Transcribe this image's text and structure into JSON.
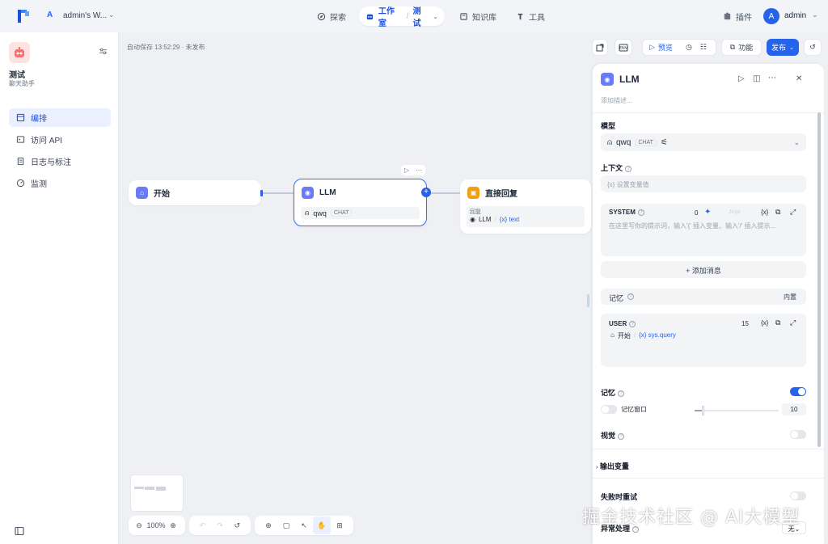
{
  "topbar": {
    "workspace_badge": "A",
    "workspace_name": "admin's W...",
    "nav": [
      {
        "label": "探索"
      },
      {
        "label": "工作室"
      },
      {
        "label": "测试"
      },
      {
        "label": "知识库"
      },
      {
        "label": "工具"
      }
    ],
    "plugins_label": "插件",
    "user_initial": "A",
    "user_name": "admin"
  },
  "sidebar": {
    "app_title": "测试",
    "app_subtitle": "聊天助手",
    "items": [
      {
        "label": "编排"
      },
      {
        "label": "访问 API"
      },
      {
        "label": "日志与标注"
      },
      {
        "label": "监测"
      }
    ]
  },
  "canvas": {
    "status": "自动保存 13:52:29 · 未发布",
    "toolbar": {
      "preview_label": "预览",
      "features_label": "功能",
      "publish_label": "发布"
    },
    "nodes": {
      "start": {
        "title": "开始"
      },
      "llm": {
        "title": "LLM",
        "model": "qwq",
        "model_tag": "CHAT"
      },
      "answer": {
        "title": "直接回复",
        "sub_label": "回复",
        "ref_node": "LLM",
        "ref_var": "{x} text"
      }
    },
    "zoom": "100%"
  },
  "panel": {
    "title": "LLM",
    "description_placeholder": "添加描述...",
    "model_label": "模型",
    "model_name": "qwq",
    "model_tag": "CHAT",
    "context_label": "上下文",
    "context_placeholder": "{x} 设置变量值",
    "system": {
      "label": "SYSTEM",
      "count": "0",
      "jinja": "Jinja",
      "placeholder": "在这里写你的提示词，输入'{' 插入变量、输入'/' 插入提示..."
    },
    "add_message_label": "+ 添加消息",
    "memory_row_label": "记忆",
    "memory_builtin": "内置",
    "user": {
      "label": "USER",
      "count": "15",
      "start_ref": "开始",
      "var_ref": "{x} sys.query"
    },
    "memory_label": "记忆",
    "memory_window_label": "记忆窗口",
    "memory_window_value": "10",
    "vision_label": "视觉",
    "output_vars_label": "输出变量",
    "retry_label": "失败时重试",
    "exception_label": "异常处理",
    "exception_value": "无"
  },
  "watermark": "掘金技术社区 @ AI大模型",
  "colors": {
    "accent": "#2563eb",
    "node_blue": "#6a7cf5",
    "node_orange": "#f59e0b"
  }
}
